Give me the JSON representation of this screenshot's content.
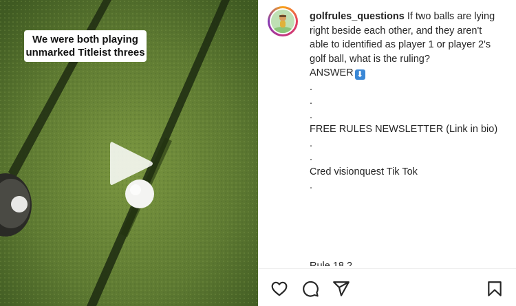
{
  "video": {
    "caption_line1": "We were both playing",
    "caption_line2": "unmarked Titleist threes",
    "play_icon": "play-icon"
  },
  "post": {
    "username": "golfrules_questions",
    "caption_lines": [
      "If two balls are lying",
      "right beside each other, and they aren't",
      "able to identified as player 1 or player 2's",
      "golf ball, what is the ruling?"
    ],
    "answer_label": "ANSWER",
    "answer_emoji": "⬇",
    "dot1": ".",
    "dot2": ".",
    "dot3": ".",
    "newsletter": "FREE RULES NEWSLETTER (Link in bio)",
    "dot4": ".",
    "dot5": ".",
    "credit": "Cred visionquest Tik Tok",
    "dot6": ".",
    "cut_text": "Rule 18.2"
  },
  "actions": {
    "icons": [
      "heart-icon",
      "comment-icon",
      "share-icon",
      "bookmark-icon"
    ]
  }
}
